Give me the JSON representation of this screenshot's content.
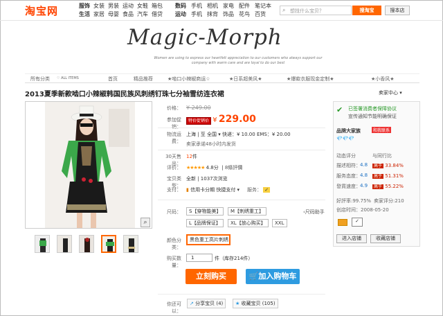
{
  "topbar": {
    "logo": "淘宝网",
    "categories_a": [
      "服饰",
      "生活",
      "女装",
      "家居",
      "男装",
      "母婴",
      "运动",
      "食品",
      "女鞋",
      "汽车",
      "箱包",
      "借贷"
    ],
    "categories_b": [
      "数码",
      "运动",
      "手机",
      "手机",
      "相机",
      "抹背",
      "家电",
      "饰品",
      "配件",
      "花鸟",
      "笔记本",
      "百货"
    ],
    "search_placeholder": "想找什么宝贝？",
    "search_button": "搜淘宝",
    "shop_button": "搜本店"
  },
  "banner": {
    "brand": "Magic-Morph",
    "tagline": "Women are using to express our heartfelt appreciation to our customers who always support our company with warm care and are loyal to do our best"
  },
  "nav": {
    "items": [
      "所有分类",
      "♡ ALL ITEMS",
      "首页",
      "精品推荐",
      "★啮口小辣椒商运☆",
      "★日系超美风★",
      "★爆款衣服现金定制★",
      "★小香风★"
    ]
  },
  "product": {
    "title": "2013夏季新款啮口小辣椒韩国民族风刺绣钉珠七分袖雪纺连衣裙",
    "seller_center": "卖家中心 ▾",
    "price_label": "价格：",
    "price_old": "¥ 249.00",
    "promo_label": "参加促销：",
    "promo_badge": "特价促销价",
    "price_new": "229.00",
    "currency": "¥",
    "shipping_label": "物流运费：",
    "shipping_text": "上海 | 至 全国 ▾   快递：¥ 10.00   EMS：¥ 20.00",
    "shipping_note": "卖家承诺48小时内发货",
    "sales_label": "30天售出：",
    "sales_count": "12",
    "sales_unit": "件",
    "rating_label": "评价：",
    "rating_stars": "★★★★★",
    "rating_score": "4.8分",
    "rating_count": "8條評價",
    "type_label": "宝贝类型：",
    "type_value": "全新 | 1037次浏览",
    "pay_label": "支付：",
    "pay_value": "信用卡分期   快捷支付 ▾",
    "service_label": "服务：",
    "size_label": "尺码：",
    "sizes": [
      "S【穿物能美】",
      "M【刺绣重工】",
      "L【品牌保证】",
      "XL【放心购买】",
      "XXL"
    ],
    "size_help": "‹尺码助手",
    "color_label": "颜色分类：",
    "color_selected": "黑色重工高片刺绣",
    "qty_label": "购买数量：",
    "qty_value": "1",
    "qty_stock": "件（库存214件）",
    "buy_now": "立刻购买",
    "add_cart": "加入购物车",
    "share_label": "你还可以：",
    "share_btn": "分享宝贝 (4)",
    "collect_btn": "收藏宝贝 (105)"
  },
  "seller": {
    "guarantee": "已签署消费者保障协议",
    "guarantee_sub": "宣传通知节能明确保证",
    "shop_name": "品牌大家族",
    "contact": "和我联系",
    "diamonds": "💎💎💎",
    "score_header": "动态评分",
    "compare_header": "与同行比",
    "scores": [
      {
        "label": "描述相符：",
        "score": "4.8",
        "tag": "高于",
        "pct": "33.84%"
      },
      {
        "label": "服务态度：",
        "score": "4.8",
        "tag": "高于",
        "pct": "51.31%"
      },
      {
        "label": "發貨速度：",
        "score": "4.9",
        "tag": "高于",
        "pct": "55.22%"
      }
    ],
    "good_rate": "好評率:99.75%",
    "fans": "卖家评分:210",
    "founded": "创店时间：2008-05-20",
    "enter_shop": "进入店铺",
    "fav_shop": "收藏店铺"
  }
}
